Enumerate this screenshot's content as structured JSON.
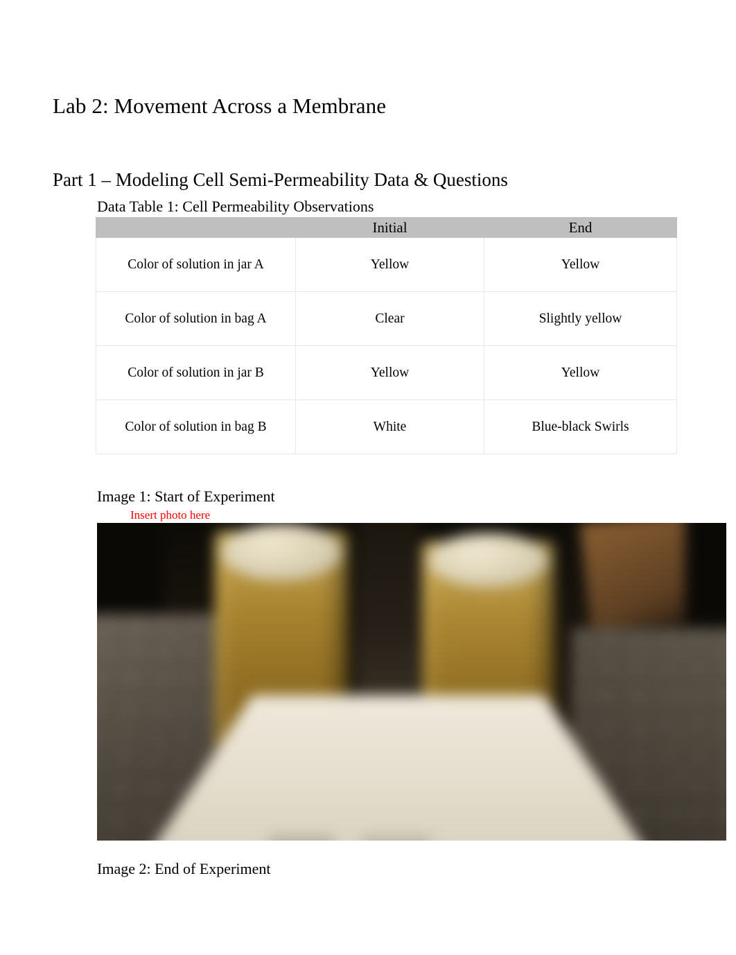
{
  "document": {
    "title": "Lab 2: Movement Across a Membrane",
    "section_heading": "Part 1 – Modeling Cell Semi-Permeability Data & Questions"
  },
  "table": {
    "caption": "Data Table 1: Cell Permeability Observations",
    "headers": [
      "",
      "Initial",
      "End"
    ],
    "rows": [
      {
        "label": "Color of solution in jar A",
        "initial": "Yellow",
        "end": "Yellow"
      },
      {
        "label": "Color of solution in bag A",
        "initial": "Clear",
        "end": "Slightly yellow"
      },
      {
        "label": "Color of solution in jar B",
        "initial": "Yellow",
        "end": "Yellow"
      },
      {
        "label": "Color of solution in bag B",
        "initial": "White",
        "end": "Blue-black Swirls"
      }
    ],
    "header_background": "#bfbfbf",
    "border_color": "#e8e8e8"
  },
  "images": {
    "image1": {
      "caption": "Image 1: Start of Experiment",
      "placeholder_note": "Insert photo here",
      "placeholder_note_color": "#ff0000",
      "alt": "Blurred photo of two jars filled with yellow solution sitting on a white sheet of paper on a speckled granite countertop"
    },
    "image2": {
      "caption": "Image 2: End of Experiment"
    }
  }
}
